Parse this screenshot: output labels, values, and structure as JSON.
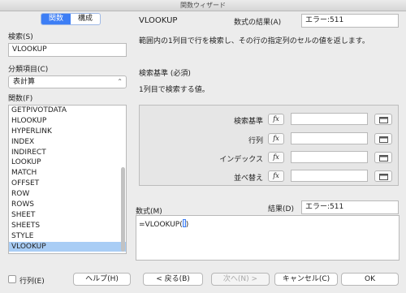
{
  "window": {
    "title": "関数ウィザード"
  },
  "tabs": [
    {
      "label": "関数",
      "active": true
    },
    {
      "label": "構成",
      "active": false
    }
  ],
  "search": {
    "label": "検索(S)",
    "value": "VLOOKUP"
  },
  "category": {
    "label": "分類項目(C)",
    "value": "表計算"
  },
  "functions": {
    "label": "関数(F)",
    "items": [
      "GETPIVOTDATA",
      "HLOOKUP",
      "HYPERLINK",
      "INDEX",
      "INDIRECT",
      "LOOKUP",
      "MATCH",
      "OFFSET",
      "ROW",
      "ROWS",
      "SHEET",
      "SHEETS",
      "STYLE",
      "VLOOKUP"
    ],
    "selected": "VLOOKUP"
  },
  "detail": {
    "function_name": "VLOOKUP",
    "result_label": "数式の結果(A)",
    "result_value": "エラー:511",
    "description": "範囲内の1列目で行を検索し、その行の指定列のセルの値を返します。",
    "param_title": "検索基準 (必須)",
    "param_desc": "1列目で検索する値。"
  },
  "arguments": [
    {
      "label": "検索基準",
      "value": ""
    },
    {
      "label": "行列",
      "value": ""
    },
    {
      "label": "インデックス",
      "value": ""
    },
    {
      "label": "並べ替え",
      "value": ""
    }
  ],
  "fx_label": "fx",
  "formula": {
    "label": "数式(M)",
    "value": "=VLOOKUP(",
    "close": ")",
    "result_label": "結果(D)",
    "result_value": "エラー:511"
  },
  "buttons": {
    "array_label": "行列(E)",
    "help": "ヘルプ(H)",
    "back": "< 戻る(B)",
    "next": "次へ(N) >",
    "cancel": "キャンセル(C)",
    "ok": "OK"
  },
  "colors": {
    "accent": "#3d7ef5",
    "selection": "#a9cdf5"
  }
}
